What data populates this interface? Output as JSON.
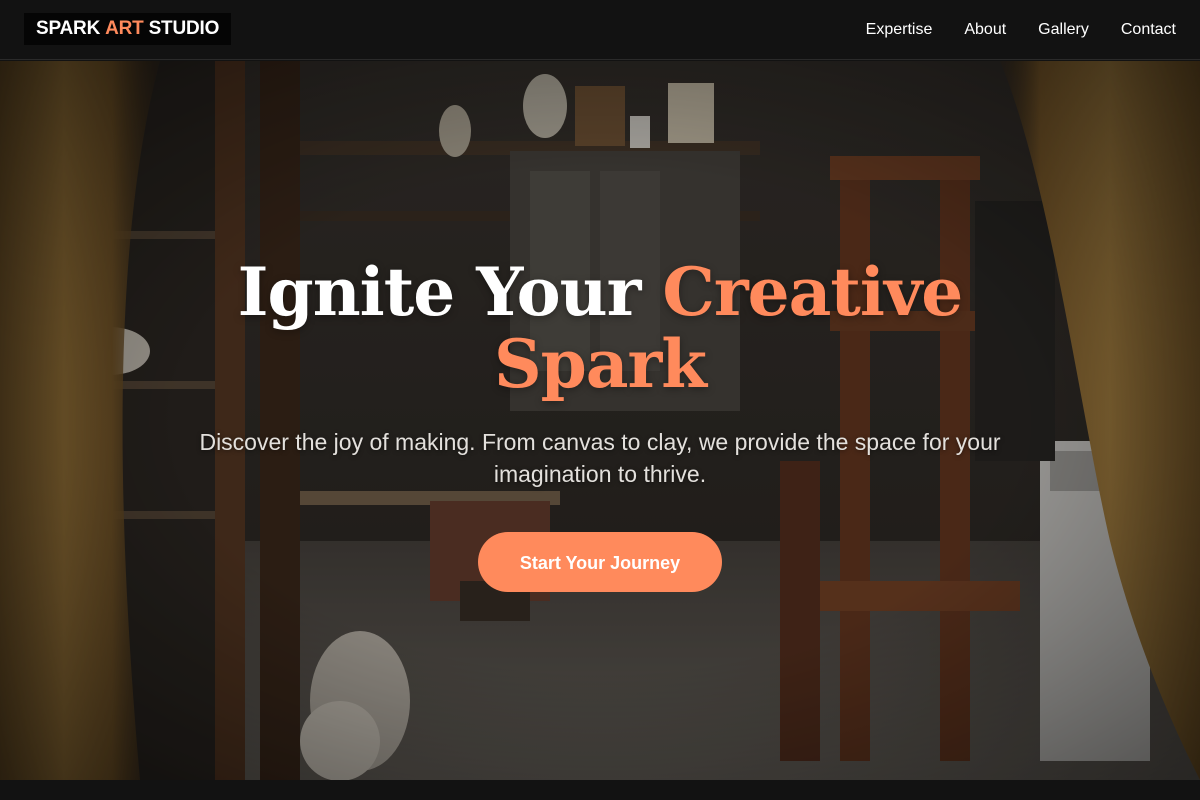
{
  "brand": {
    "part1": "SPARK",
    "part2": "ART",
    "part3": "STUDIO",
    "accent_color": "#ff8a5c"
  },
  "nav": {
    "items": [
      {
        "label": "Expertise"
      },
      {
        "label": "About"
      },
      {
        "label": "Gallery"
      },
      {
        "label": "Contact"
      }
    ]
  },
  "hero": {
    "title_white": "Ignite Your ",
    "title_accent_1": "Creative",
    "title_accent_2": "Spark",
    "subtitle": "Discover the joy of making. From canvas to clay, we provide the space for your imagination to thrive.",
    "cta_label": "Start Your Journey",
    "background": "art-studio-workshop-photo"
  },
  "colors": {
    "navbar_bg": "#121212",
    "accent": "#ff8a5c",
    "text": "#ffffff"
  }
}
